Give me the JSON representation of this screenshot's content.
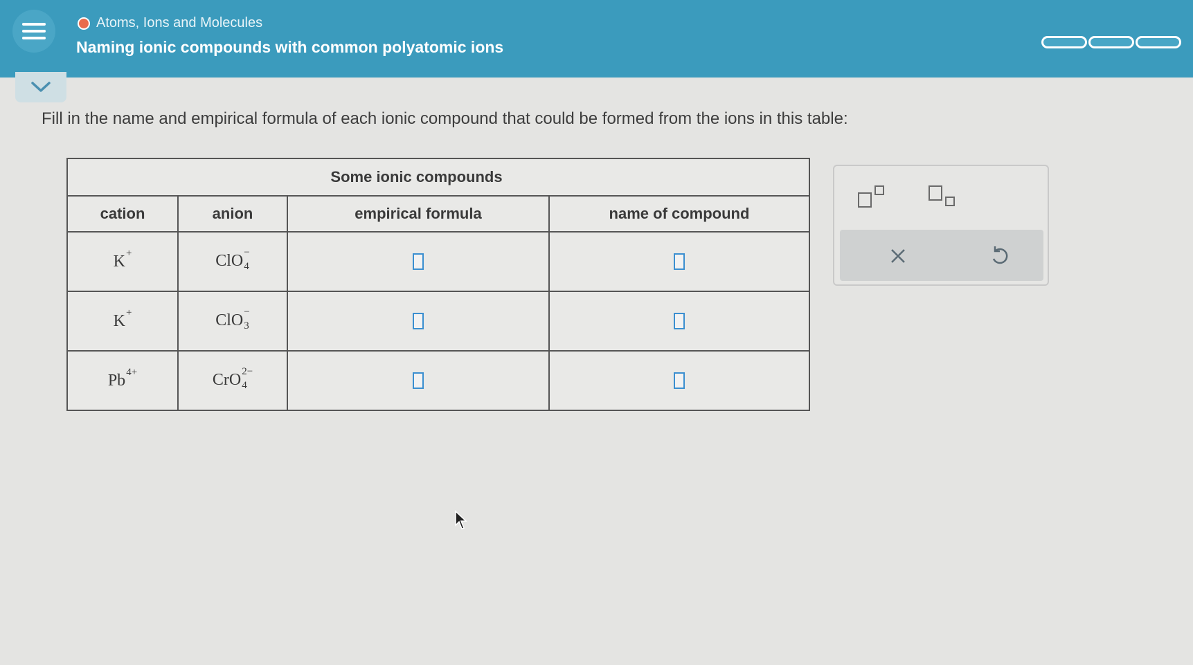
{
  "header": {
    "topic": "Atoms, Ions and Molecules",
    "title": "Naming ionic compounds with common polyatomic ions",
    "progress_segments": 3
  },
  "instructions": "Fill in the name and empirical formula of each ionic compound that could be formed from the ions in this table:",
  "table": {
    "caption": "Some ionic compounds",
    "headers": {
      "cation": "cation",
      "anion": "anion",
      "formula": "empirical formula",
      "name": "name of compound"
    },
    "rows": [
      {
        "cation": {
          "base": "K",
          "charge": "+"
        },
        "anion": {
          "base": "ClO",
          "sub": "4",
          "charge": "−"
        }
      },
      {
        "cation": {
          "base": "K",
          "charge": "+"
        },
        "anion": {
          "base": "ClO",
          "sub": "3",
          "charge": "−"
        }
      },
      {
        "cation": {
          "base": "Pb",
          "charge": "4+"
        },
        "anion": {
          "base": "CrO",
          "sub": "4",
          "charge": "2−"
        }
      }
    ]
  },
  "tools": {
    "superscript": "superscript-template-icon",
    "subscript": "subscript-template-icon",
    "clear": "×",
    "undo": "↺"
  },
  "colors": {
    "header_bg": "#3b9bbd",
    "accent_dot": "#e96b4c",
    "answer_box_border": "#3b8fd0",
    "page_bg": "#e4e4e2"
  }
}
